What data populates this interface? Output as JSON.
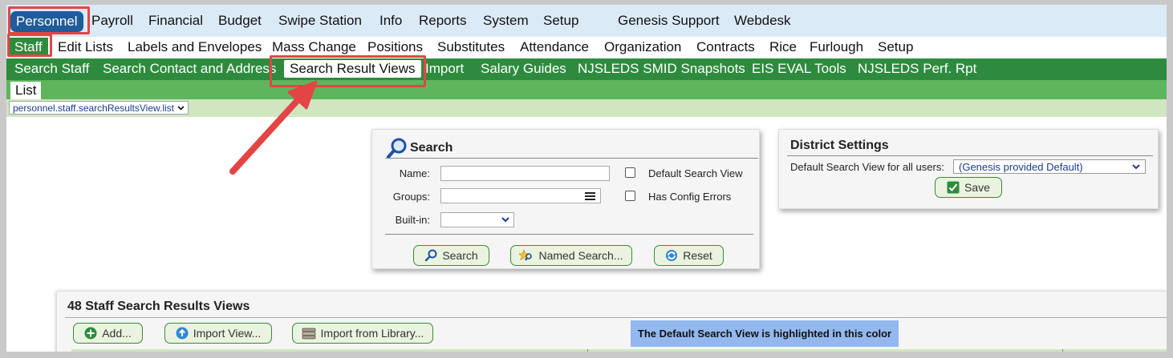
{
  "top_menu": {
    "active": "Personnel",
    "items": [
      "Payroll",
      "Financial",
      "Budget",
      "Swipe Station",
      "Info",
      "Reports",
      "System",
      "Setup",
      "Genesis Support",
      "Webdesk"
    ]
  },
  "sub_menu": {
    "active": "Staff",
    "items": [
      "Edit Lists",
      "Labels and Envelopes",
      "Mass Change",
      "Positions",
      "Substitutes",
      "Attendance",
      "Organization",
      "Contracts",
      "Rice",
      "Furlough",
      "Setup"
    ]
  },
  "tab_bar": {
    "items": [
      "Search Staff",
      "Search Contact and Address",
      "Import",
      "Salary Guides",
      "NJSLEDS SMID Snapshots",
      "EIS EVAL Tools",
      "NJSLEDS Perf. Rpt"
    ],
    "active": "Search Result Views"
  },
  "list_bar": {
    "active": "List"
  },
  "path_select": {
    "value": "personnel.staff.searchResultsView.list"
  },
  "search_panel": {
    "title": "Search",
    "name_label": "Name:",
    "groups_label": "Groups:",
    "builtin_label": "Built-in:",
    "builtin_value": "",
    "default_view_label": "Default Search View",
    "config_errors_label": "Has Config Errors",
    "search_button": "Search",
    "named_search_button": "Named Search...",
    "reset_button": "Reset"
  },
  "district_settings": {
    "title": "District Settings",
    "default_view_label": "Default Search View for all users:",
    "default_view_value": "(Genesis provided Default)",
    "save_button": "Save"
  },
  "results": {
    "title": "48 Staff Search Results Views",
    "add_button": "Add...",
    "import_view_button": "Import View...",
    "import_library_button": "Import from Library...",
    "legend_text": "The Default Search View is highlighted in this color"
  },
  "colors": {
    "primary_green": "#2e8b3e",
    "light_green": "#5fb55c",
    "nav_blue": "#1f5c99",
    "highlight_blue": "#93b8f0",
    "annotation_red": "#e34545"
  }
}
